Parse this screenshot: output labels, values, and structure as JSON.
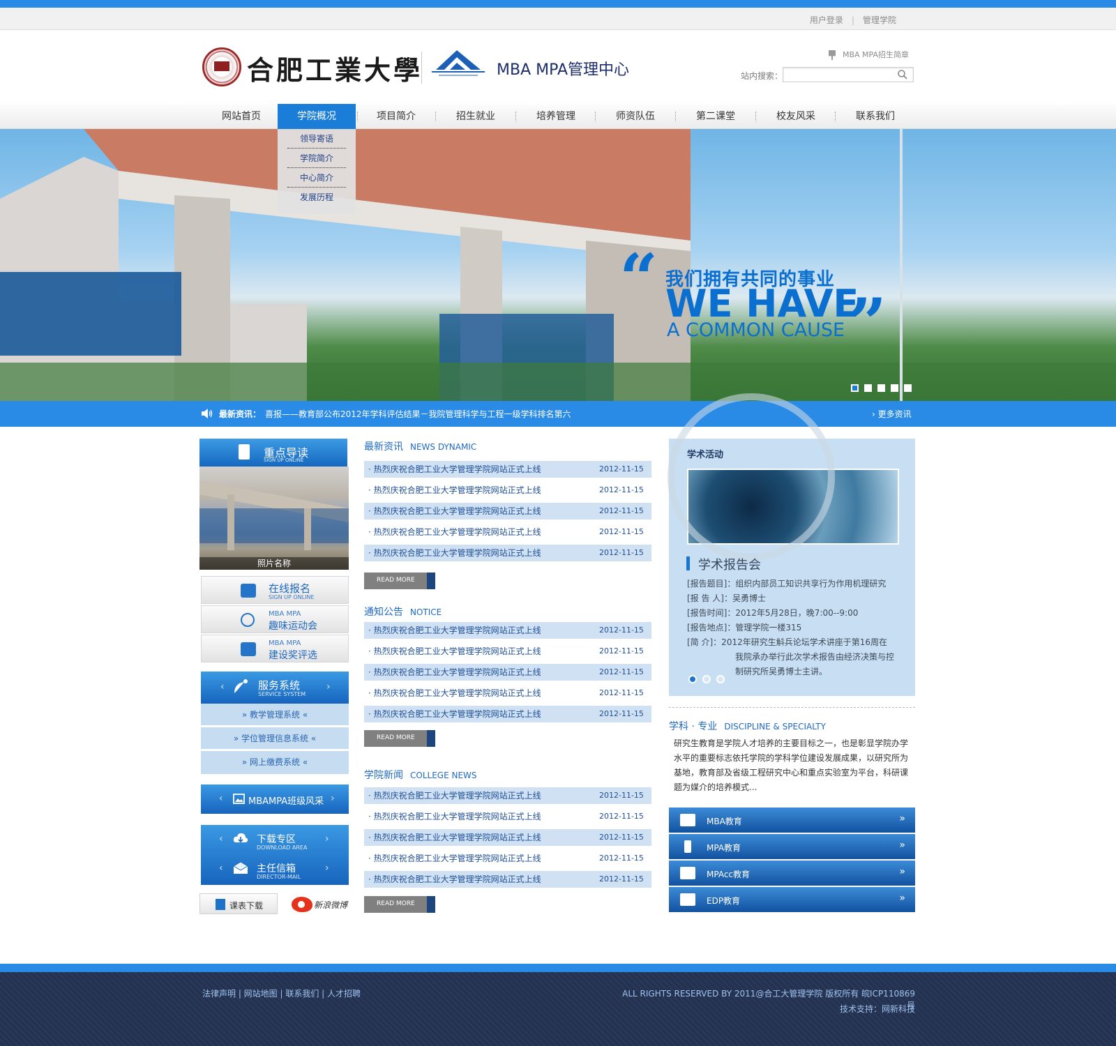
{
  "topbar": {
    "login": "用户登录",
    "school": "管理学院"
  },
  "header": {
    "university_name": "合肥工業大學",
    "center_name": "MBA MPA管理中心",
    "brochure_link": "MBA MPA招生简章",
    "search_label": "站内搜索："
  },
  "nav": {
    "items": [
      "网站首页",
      "学院概况",
      "项目简介",
      "招生就业",
      "培养管理",
      "师资队伍",
      "第二课堂",
      "校友风采",
      "联系我们"
    ],
    "active_index": 1,
    "dropdown": [
      "领导寄语",
      "学院简介",
      "中心简介",
      "发展历程"
    ]
  },
  "banner": {
    "slogan_cn": "我们拥有共同的事业",
    "slogan_en_line1": "WE HAVE",
    "slogan_en_line2": "A COMMON CAUSE",
    "slide_count": 5,
    "active_slide": 0
  },
  "ticker": {
    "label": "最新资讯：",
    "text": "喜报——教育部公布2012年学科评估结果－我院管理科学与工程一级学科排名第六",
    "more": "更多资讯"
  },
  "left": {
    "key_guide": {
      "title": "重点导读",
      "subtitle": "SIGN UP ONLINE"
    },
    "photo_caption": "照片名称",
    "buttons": [
      {
        "big": "在线报名",
        "small": "SIGN UP ONLINE",
        "icon": "clipboard-icon"
      },
      {
        "small": "MBA MPA",
        "big": "趣味运动会",
        "icon": "bicycle-icon"
      },
      {
        "small": "MBA MPA",
        "big": "建设奖评选",
        "icon": "gift-icon"
      }
    ],
    "service": {
      "title": "服务系统",
      "subtitle": "SERVICE SYSTEM",
      "items": [
        "教学管理系统",
        "学位管理信息系统",
        "网上缴费系统"
      ]
    },
    "class_style": "MBAMPA班级风采",
    "download": {
      "title": "下载专区",
      "subtitle": "DOWNLOAD AREA"
    },
    "mail": {
      "title": "主任信箱",
      "subtitle": "DIRECTOR-MAIL"
    },
    "schedule_download": "课表下载",
    "weibo": "新浪微博"
  },
  "middle": {
    "sections": [
      {
        "title": "最新资讯",
        "title_en": "NEWS DYNAMIC",
        "items": [
          {
            "title": "热烈庆祝合肥工业大学管理学院网站正式上线",
            "date": "2012-11-15"
          },
          {
            "title": "热烈庆祝合肥工业大学管理学院网站正式上线",
            "date": "2012-11-15"
          },
          {
            "title": "热烈庆祝合肥工业大学管理学院网站正式上线",
            "date": "2012-11-15"
          },
          {
            "title": "热烈庆祝合肥工业大学管理学院网站正式上线",
            "date": "2012-11-15"
          },
          {
            "title": "热烈庆祝合肥工业大学管理学院网站正式上线",
            "date": "2012-11-15"
          }
        ],
        "more": "READ MORE"
      },
      {
        "title": "通知公告",
        "title_en": "NOTICE",
        "items": [
          {
            "title": "热烈庆祝合肥工业大学管理学院网站正式上线",
            "date": "2012-11-15"
          },
          {
            "title": "热烈庆祝合肥工业大学管理学院网站正式上线",
            "date": "2012-11-15"
          },
          {
            "title": "热烈庆祝合肥工业大学管理学院网站正式上线",
            "date": "2012-11-15"
          },
          {
            "title": "热烈庆祝合肥工业大学管理学院网站正式上线",
            "date": "2012-11-15"
          },
          {
            "title": "热烈庆祝合肥工业大学管理学院网站正式上线",
            "date": "2012-11-15"
          }
        ],
        "more": "READ MORE"
      },
      {
        "title": "学院新闻",
        "title_en": "COLLEGE NEWS",
        "items": [
          {
            "title": "热烈庆祝合肥工业大学管理学院网站正式上线",
            "date": "2012-11-15"
          },
          {
            "title": "热烈庆祝合肥工业大学管理学院网站正式上线",
            "date": "2012-11-15"
          },
          {
            "title": "热烈庆祝合肥工业大学管理学院网站正式上线",
            "date": "2012-11-15"
          },
          {
            "title": "热烈庆祝合肥工业大学管理学院网站正式上线",
            "date": "2012-11-15"
          },
          {
            "title": "热烈庆祝合肥工业大学管理学院网站正式上线",
            "date": "2012-11-15"
          }
        ],
        "more": "READ MORE"
      }
    ]
  },
  "right": {
    "academic": {
      "title": "学术活动",
      "subtitle": "学术报告会",
      "lines": [
        "[报告题目]：组织内部员工知识共享行为作用机理研究",
        "[报 告 人]：吴勇博士",
        "[报告时间]：2012年5月28日，晚7:00--9:00",
        "[报告地点]：管理学院一楼315",
        "[简      介]：2012年研究生斛兵论坛学术讲座于第16周在",
        "我院承办举行此次学术报告由经济决策与控",
        "制研究所吴勇博士主讲。"
      ],
      "dots": 3,
      "active_dot": 0
    },
    "discipline": {
      "title": "学科 · 专业",
      "title_en": "DISCIPLINE & SPECIALTY",
      "text": "研究生教育是学院人才培养的主要目标之一，也是彰显学院办学水平的重要标志依托学院的学科学位建设发展成果，以研究所为基地，教育部及省级工程研究中心和重点实验室为平台，科研课题为媒介的培养模式..."
    },
    "education": [
      {
        "label": "MBA教育",
        "icon": "graduation-cap-icon"
      },
      {
        "label": "MPA教育",
        "icon": "tie-icon"
      },
      {
        "label": "MPAcc教育",
        "icon": "briefcase-icon"
      },
      {
        "label": "EDP教育",
        "icon": "toolbox-icon"
      }
    ]
  },
  "footer": {
    "links": "法律声明 | 网站地图 | 联系我们 | 人才招聘",
    "copyright": "ALL RIGHTS RESERVED BY 2011@合工大管理学院   版权所有 皖ICP110869号",
    "support": "技术支持：网新科技"
  },
  "colors": {
    "primary": "#2a8be6",
    "nav_active": "#1a7ed9",
    "footer_bg": "#243252",
    "panel_bg": "#c8def2",
    "row_alt": "#cfe1f3"
  }
}
